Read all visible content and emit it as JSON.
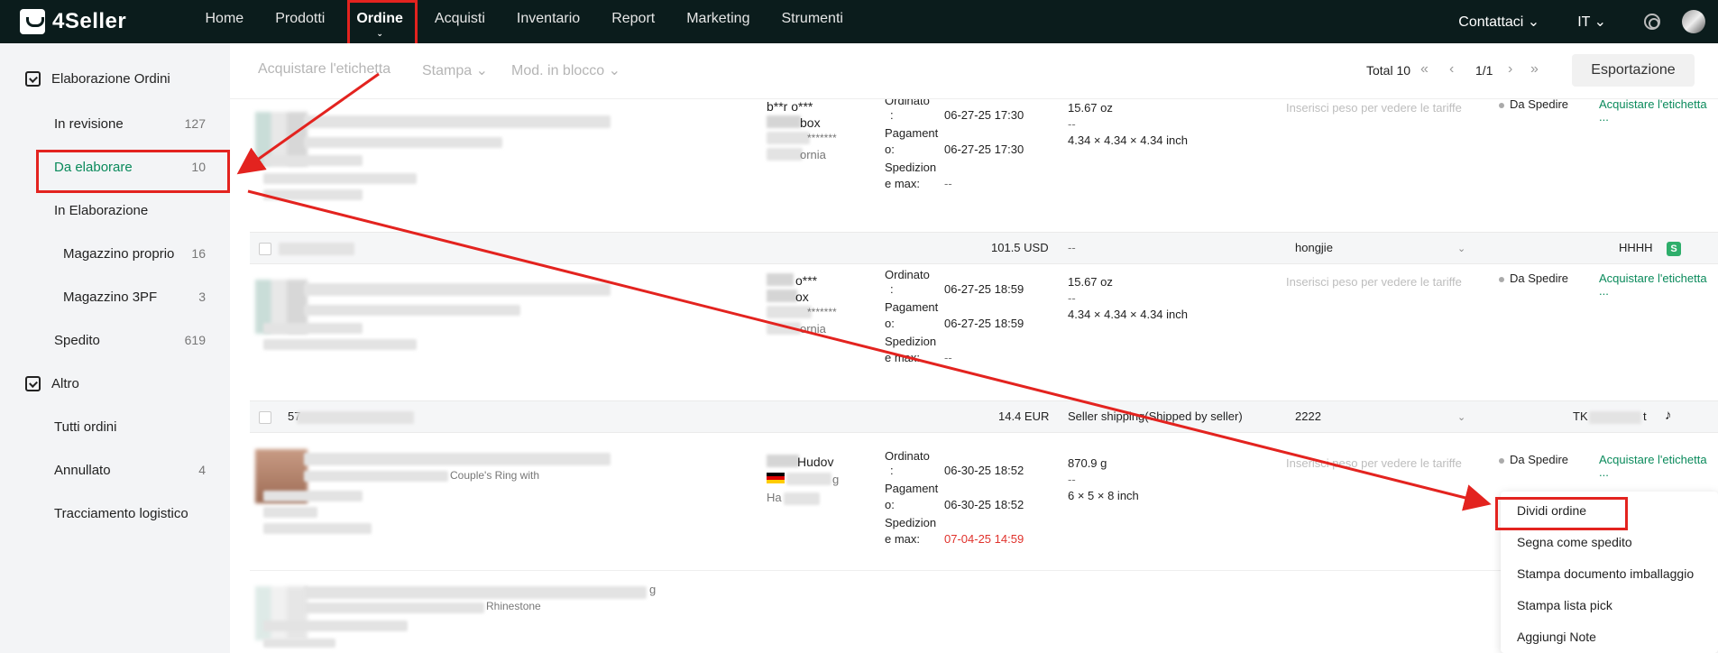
{
  "app": {
    "logo": "4Seller"
  },
  "nav": {
    "items": [
      "Home",
      "Prodotti",
      "Ordine",
      "Acquisti",
      "Inventario",
      "Report",
      "Marketing",
      "Strumenti"
    ],
    "active": "Ordine",
    "contact": "Contattaci",
    "lang": "IT"
  },
  "sidebar": {
    "group1": "Elaborazione Ordini",
    "items": [
      {
        "label": "In revisione",
        "count": "127"
      },
      {
        "label": "Da elaborare",
        "count": "10"
      },
      {
        "label": "In Elaborazione",
        "count": ""
      },
      {
        "label": "Magazzino proprio",
        "count": "16"
      },
      {
        "label": "Magazzino 3PF",
        "count": "3"
      },
      {
        "label": "Spedito",
        "count": "619"
      }
    ],
    "group2": "Altro",
    "items2": [
      {
        "label": "Tutti ordini",
        "count": ""
      },
      {
        "label": "Annullato",
        "count": "4"
      },
      {
        "label": "Tracciamento logistico",
        "count": ""
      }
    ]
  },
  "toolbar": {
    "buy_label": "Acquistare l'etichetta",
    "print_label": "Stampa",
    "bulk_label": "Mod. in blocco",
    "total_label": "Total 10",
    "page": "1/1",
    "export_label": "Esportazione",
    "first_icon": "«",
    "prev_icon": "‹",
    "next_icon": "›",
    "last_icon": "»"
  },
  "orders": [
    {
      "buyer_name": "b**r o***",
      "buyer_line2": "box",
      "buyer_line3": "*******",
      "buyer_line4": "ornia",
      "ordered_label": "Ordinato",
      "colon": ":",
      "ordered_date": "06-27-25 17:30",
      "paid_label1": "Pagament",
      "paid_label2": "o:",
      "paid_date": "06-27-25 17:30",
      "ship_label1": "Spedizion",
      "ship_label2": "e max:",
      "ship_date": "--",
      "weight": "15.67 oz",
      "dash": "--",
      "dims": "4.34 × 4.34 × 4.34 inch",
      "weight_hint": "Inserisci peso per vedere le tariffe",
      "status": "Da Spedire",
      "action": "Acquistare l'etichetta",
      "more": "...",
      "footer": {
        "amount": "101.5 USD",
        "shipping": "--",
        "warehouse": "hongjie",
        "shop": "HHHH",
        "badge": "S"
      }
    },
    {
      "buyer_name": "o***",
      "buyer_line2": "ox",
      "buyer_line3": "*******",
      "buyer_line4": "ornia",
      "ordered_label": "Ordinato",
      "colon": ":",
      "ordered_date": "06-27-25 18:59",
      "paid_label1": "Pagament",
      "paid_label2": "o:",
      "paid_date": "06-27-25 18:59",
      "ship_label1": "Spedizion",
      "ship_label2": "e max:",
      "ship_date": "--",
      "weight": "15.67 oz",
      "dash": "--",
      "dims": "4.34 × 4.34 × 4.34 inch",
      "weight_hint": "Inserisci peso per vedere le tariffe",
      "status": "Da Spedire",
      "action": "Acquistare l'etichetta",
      "more": "...",
      "footer": {
        "order_prefix": "57",
        "amount": "14.4 EUR",
        "shipping": "Seller shipping(Shipped by seller)",
        "warehouse": "2222",
        "shop": "TK",
        "shop_suffix": "t",
        "badge": "♪"
      }
    },
    {
      "buyer_name": "Hudov",
      "buyer_line2": "g",
      "buyer_line3": "Ha",
      "product_hint": "Couple's Ring with",
      "ordered_label": "Ordinato",
      "colon": ":",
      "ordered_date": "06-30-25 18:52",
      "paid_label1": "Pagament",
      "paid_label2": "o:",
      "paid_date": "06-30-25 18:52",
      "ship_label1": "Spedizion",
      "ship_label2": "e max:",
      "ship_date": "07-04-25 14:59",
      "weight": "870.9 g",
      "dash": "--",
      "dims": "6 × 5 × 8 inch",
      "weight_hint": "Inserisci peso per vedere le tariffe",
      "status": "Da Spedire",
      "action": "Acquistare l'etichetta",
      "more": "..."
    },
    {
      "product_hint": "Rhinestone",
      "product_suffix": "g"
    }
  ],
  "context_menu": {
    "items": [
      "Dividi ordine",
      "Segna come spedito",
      "Stampa documento imballaggio",
      "Stampa lista pick",
      "Aggiungi Note"
    ]
  },
  "colors": {
    "topbar": "#0b1c1c",
    "accent_green": "#0a8a5b",
    "annotation_red": "#e3231f",
    "deadline_red": "#e0322c"
  }
}
